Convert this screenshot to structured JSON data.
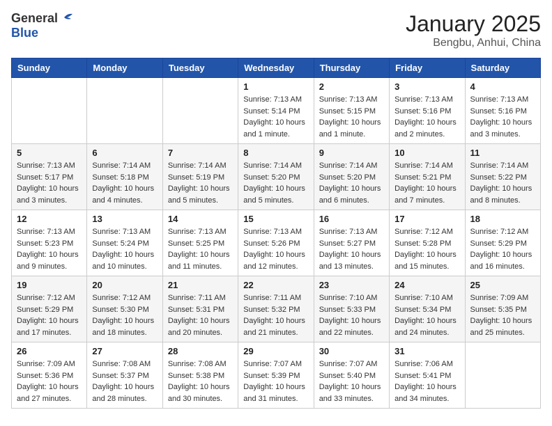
{
  "header": {
    "logo_general": "General",
    "logo_blue": "Blue",
    "month": "January 2025",
    "location": "Bengbu, Anhui, China"
  },
  "days_of_week": [
    "Sunday",
    "Monday",
    "Tuesday",
    "Wednesday",
    "Thursday",
    "Friday",
    "Saturday"
  ],
  "weeks": [
    [
      {
        "day": "",
        "info": ""
      },
      {
        "day": "",
        "info": ""
      },
      {
        "day": "",
        "info": ""
      },
      {
        "day": "1",
        "info": "Sunrise: 7:13 AM\nSunset: 5:14 PM\nDaylight: 10 hours\nand 1 minute."
      },
      {
        "day": "2",
        "info": "Sunrise: 7:13 AM\nSunset: 5:15 PM\nDaylight: 10 hours\nand 1 minute."
      },
      {
        "day": "3",
        "info": "Sunrise: 7:13 AM\nSunset: 5:16 PM\nDaylight: 10 hours\nand 2 minutes."
      },
      {
        "day": "4",
        "info": "Sunrise: 7:13 AM\nSunset: 5:16 PM\nDaylight: 10 hours\nand 3 minutes."
      }
    ],
    [
      {
        "day": "5",
        "info": "Sunrise: 7:13 AM\nSunset: 5:17 PM\nDaylight: 10 hours\nand 3 minutes."
      },
      {
        "day": "6",
        "info": "Sunrise: 7:14 AM\nSunset: 5:18 PM\nDaylight: 10 hours\nand 4 minutes."
      },
      {
        "day": "7",
        "info": "Sunrise: 7:14 AM\nSunset: 5:19 PM\nDaylight: 10 hours\nand 5 minutes."
      },
      {
        "day": "8",
        "info": "Sunrise: 7:14 AM\nSunset: 5:20 PM\nDaylight: 10 hours\nand 5 minutes."
      },
      {
        "day": "9",
        "info": "Sunrise: 7:14 AM\nSunset: 5:20 PM\nDaylight: 10 hours\nand 6 minutes."
      },
      {
        "day": "10",
        "info": "Sunrise: 7:14 AM\nSunset: 5:21 PM\nDaylight: 10 hours\nand 7 minutes."
      },
      {
        "day": "11",
        "info": "Sunrise: 7:14 AM\nSunset: 5:22 PM\nDaylight: 10 hours\nand 8 minutes."
      }
    ],
    [
      {
        "day": "12",
        "info": "Sunrise: 7:13 AM\nSunset: 5:23 PM\nDaylight: 10 hours\nand 9 minutes."
      },
      {
        "day": "13",
        "info": "Sunrise: 7:13 AM\nSunset: 5:24 PM\nDaylight: 10 hours\nand 10 minutes."
      },
      {
        "day": "14",
        "info": "Sunrise: 7:13 AM\nSunset: 5:25 PM\nDaylight: 10 hours\nand 11 minutes."
      },
      {
        "day": "15",
        "info": "Sunrise: 7:13 AM\nSunset: 5:26 PM\nDaylight: 10 hours\nand 12 minutes."
      },
      {
        "day": "16",
        "info": "Sunrise: 7:13 AM\nSunset: 5:27 PM\nDaylight: 10 hours\nand 13 minutes."
      },
      {
        "day": "17",
        "info": "Sunrise: 7:12 AM\nSunset: 5:28 PM\nDaylight: 10 hours\nand 15 minutes."
      },
      {
        "day": "18",
        "info": "Sunrise: 7:12 AM\nSunset: 5:29 PM\nDaylight: 10 hours\nand 16 minutes."
      }
    ],
    [
      {
        "day": "19",
        "info": "Sunrise: 7:12 AM\nSunset: 5:29 PM\nDaylight: 10 hours\nand 17 minutes."
      },
      {
        "day": "20",
        "info": "Sunrise: 7:12 AM\nSunset: 5:30 PM\nDaylight: 10 hours\nand 18 minutes."
      },
      {
        "day": "21",
        "info": "Sunrise: 7:11 AM\nSunset: 5:31 PM\nDaylight: 10 hours\nand 20 minutes."
      },
      {
        "day": "22",
        "info": "Sunrise: 7:11 AM\nSunset: 5:32 PM\nDaylight: 10 hours\nand 21 minutes."
      },
      {
        "day": "23",
        "info": "Sunrise: 7:10 AM\nSunset: 5:33 PM\nDaylight: 10 hours\nand 22 minutes."
      },
      {
        "day": "24",
        "info": "Sunrise: 7:10 AM\nSunset: 5:34 PM\nDaylight: 10 hours\nand 24 minutes."
      },
      {
        "day": "25",
        "info": "Sunrise: 7:09 AM\nSunset: 5:35 PM\nDaylight: 10 hours\nand 25 minutes."
      }
    ],
    [
      {
        "day": "26",
        "info": "Sunrise: 7:09 AM\nSunset: 5:36 PM\nDaylight: 10 hours\nand 27 minutes."
      },
      {
        "day": "27",
        "info": "Sunrise: 7:08 AM\nSunset: 5:37 PM\nDaylight: 10 hours\nand 28 minutes."
      },
      {
        "day": "28",
        "info": "Sunrise: 7:08 AM\nSunset: 5:38 PM\nDaylight: 10 hours\nand 30 minutes."
      },
      {
        "day": "29",
        "info": "Sunrise: 7:07 AM\nSunset: 5:39 PM\nDaylight: 10 hours\nand 31 minutes."
      },
      {
        "day": "30",
        "info": "Sunrise: 7:07 AM\nSunset: 5:40 PM\nDaylight: 10 hours\nand 33 minutes."
      },
      {
        "day": "31",
        "info": "Sunrise: 7:06 AM\nSunset: 5:41 PM\nDaylight: 10 hours\nand 34 minutes."
      },
      {
        "day": "",
        "info": ""
      }
    ]
  ]
}
